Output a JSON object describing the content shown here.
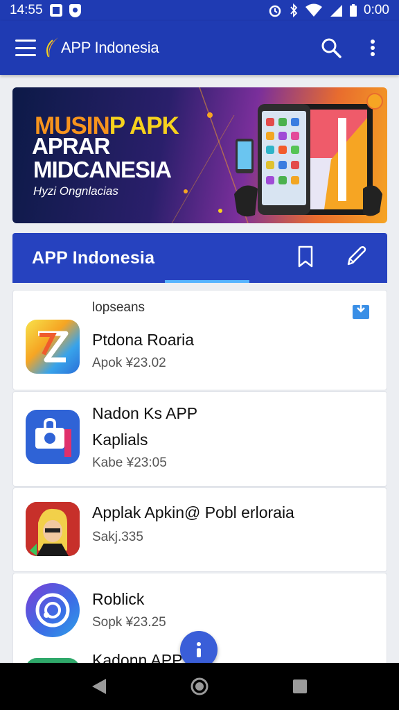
{
  "status_bar": {
    "time_left": "14:55",
    "time_right": "0:00"
  },
  "app_bar": {
    "title": "APP Indonesia",
    "menu_icon": "hamburger-menu-icon",
    "search_icon": "search-icon",
    "more_icon": "more-vertical-icon",
    "color": "#1f3bb3"
  },
  "banner": {
    "line1_a": "MUSIN",
    "line1_b": "P APK",
    "line2": "APRAR",
    "line3": "MIDCANESIA",
    "line4": "Hyzi Ongnlacias"
  },
  "section": {
    "title": "APP  Indonesia",
    "bookmark_icon": "bookmark-icon",
    "edit_icon": "pen-icon",
    "color": "#2642bf"
  },
  "apps": [
    {
      "category": "lopseans",
      "name": "Ptdona Roaria",
      "meta": "Apok ¥23.02"
    },
    {
      "category": "Nadon Ks APP",
      "name": "Kaplials",
      "meta": "Kabe ¥23:05"
    },
    {
      "category": "",
      "name": "Applak Apkin@ Pobl erloraia",
      "meta": "Sakj.335"
    },
    {
      "category": "",
      "name": "Roblick",
      "meta": "Sopk ¥23.25"
    },
    {
      "category": "",
      "name": "Kadonn APP",
      "meta": ""
    }
  ],
  "fab": {
    "icon": "info-icon"
  },
  "nav": {
    "back": "back-icon",
    "home": "home-icon",
    "recents": "recents-icon"
  }
}
